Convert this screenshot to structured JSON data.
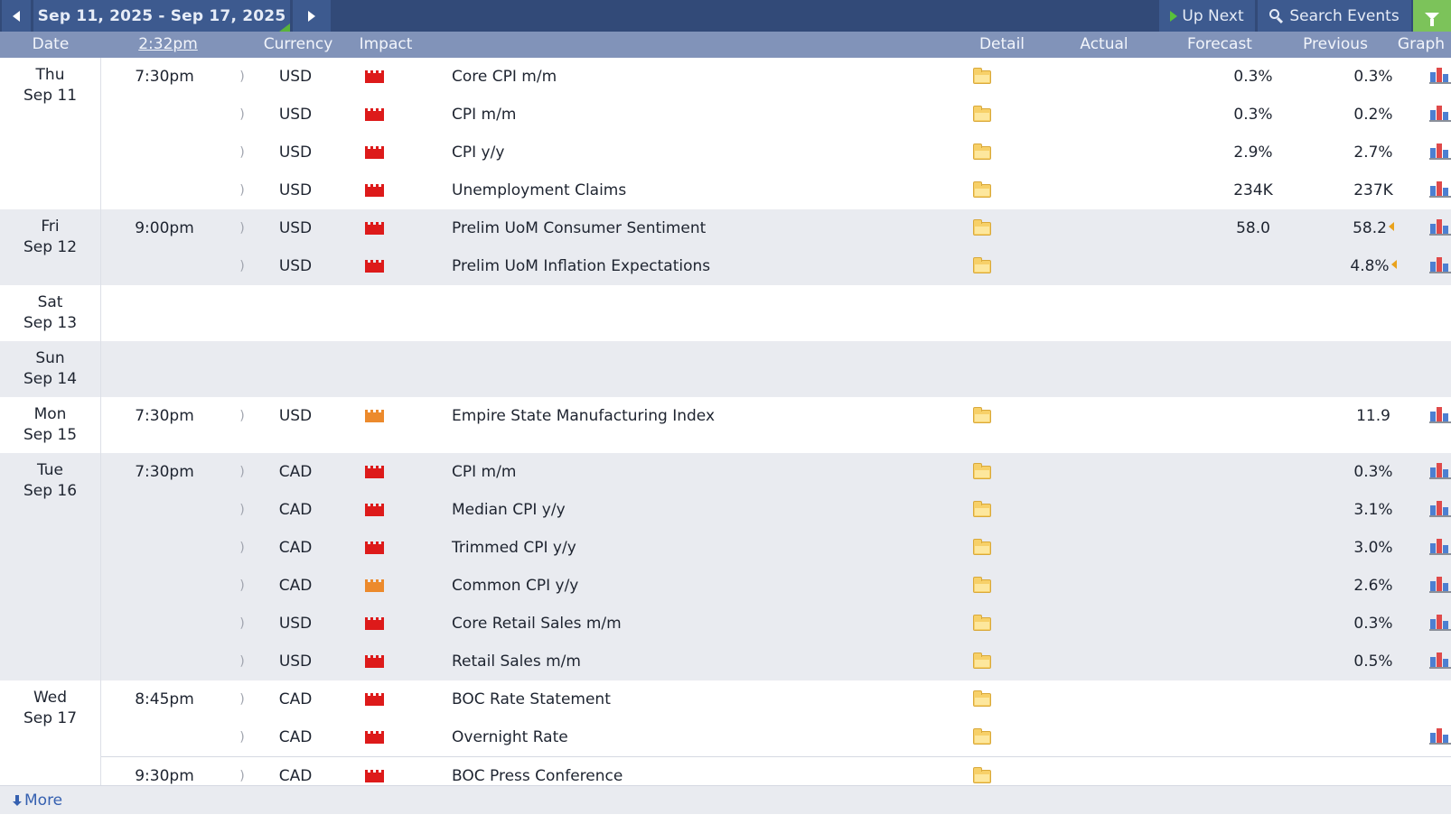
{
  "toolbar": {
    "date_range": "Sep 11, 2025 - Sep 17, 2025",
    "up_next_label": "Up Next",
    "search_label": "Search Events",
    "accent_color": "#324a78",
    "filter_color": "#7cc35a",
    "prev_icon": "triangle-left-icon",
    "next_icon": "triangle-right-icon",
    "search_icon": "magnifier-icon",
    "filter_icon": "funnel-icon"
  },
  "header": {
    "date": "Date",
    "time": "2:32pm",
    "currency": "Currency",
    "impact": "Impact",
    "detail": "Detail",
    "actual": "Actual",
    "forecast": "Forecast",
    "previous": "Previous",
    "graph": "Graph"
  },
  "impact_colors": {
    "high": "#dd1a1a",
    "medium": "#ec8a2c"
  },
  "days": [
    {
      "weekday": "Thu",
      "date": "Sep 11",
      "events": [
        {
          "time": "7:30pm",
          "currency": "USD",
          "impact": "high",
          "name": "Core CPI m/m",
          "actual": "",
          "forecast": "0.3%",
          "previous": "0.3%",
          "revised": false,
          "graph": true
        },
        {
          "time": "",
          "currency": "USD",
          "impact": "high",
          "name": "CPI m/m",
          "actual": "",
          "forecast": "0.3%",
          "previous": "0.2%",
          "revised": false,
          "graph": true
        },
        {
          "time": "",
          "currency": "USD",
          "impact": "high",
          "name": "CPI y/y",
          "actual": "",
          "forecast": "2.9%",
          "previous": "2.7%",
          "revised": false,
          "graph": true
        },
        {
          "time": "",
          "currency": "USD",
          "impact": "high",
          "name": "Unemployment Claims",
          "actual": "",
          "forecast": "234K",
          "previous": "237K",
          "revised": false,
          "graph": true
        }
      ]
    },
    {
      "weekday": "Fri",
      "date": "Sep 12",
      "events": [
        {
          "time": "9:00pm",
          "currency": "USD",
          "impact": "high",
          "name": "Prelim UoM Consumer Sentiment",
          "actual": "",
          "forecast": "58.0",
          "previous": "58.2",
          "revised": true,
          "graph": true
        },
        {
          "time": "",
          "currency": "USD",
          "impact": "high",
          "name": "Prelim UoM Inflation Expectations",
          "actual": "",
          "forecast": "",
          "previous": "4.8%",
          "revised": true,
          "graph": true
        }
      ]
    },
    {
      "weekday": "Sat",
      "date": "Sep 13",
      "events": []
    },
    {
      "weekday": "Sun",
      "date": "Sep 14",
      "events": []
    },
    {
      "weekday": "Mon",
      "date": "Sep 15",
      "events": [
        {
          "time": "7:30pm",
          "currency": "USD",
          "impact": "medium",
          "name": "Empire State Manufacturing Index",
          "actual": "",
          "forecast": "",
          "previous": "11.9",
          "revised": false,
          "graph": true
        }
      ]
    },
    {
      "weekday": "Tue",
      "date": "Sep 16",
      "events": [
        {
          "time": "7:30pm",
          "currency": "CAD",
          "impact": "high",
          "name": "CPI m/m",
          "actual": "",
          "forecast": "",
          "previous": "0.3%",
          "revised": false,
          "graph": true
        },
        {
          "time": "",
          "currency": "CAD",
          "impact": "high",
          "name": "Median CPI y/y",
          "actual": "",
          "forecast": "",
          "previous": "3.1%",
          "revised": false,
          "graph": true
        },
        {
          "time": "",
          "currency": "CAD",
          "impact": "high",
          "name": "Trimmed CPI y/y",
          "actual": "",
          "forecast": "",
          "previous": "3.0%",
          "revised": false,
          "graph": true
        },
        {
          "time": "",
          "currency": "CAD",
          "impact": "medium",
          "name": "Common CPI y/y",
          "actual": "",
          "forecast": "",
          "previous": "2.6%",
          "revised": false,
          "graph": true
        },
        {
          "time": "",
          "currency": "USD",
          "impact": "high",
          "name": "Core Retail Sales m/m",
          "actual": "",
          "forecast": "",
          "previous": "0.3%",
          "revised": false,
          "graph": true
        },
        {
          "time": "",
          "currency": "USD",
          "impact": "high",
          "name": "Retail Sales m/m",
          "actual": "",
          "forecast": "",
          "previous": "0.5%",
          "revised": false,
          "graph": true
        }
      ]
    },
    {
      "weekday": "Wed",
      "date": "Sep 17",
      "events": [
        {
          "time": "8:45pm",
          "currency": "CAD",
          "impact": "high",
          "name": "BOC Rate Statement",
          "actual": "",
          "forecast": "",
          "previous": "",
          "revised": false,
          "graph": false
        },
        {
          "time": "",
          "currency": "CAD",
          "impact": "high",
          "name": "Overnight Rate",
          "actual": "",
          "forecast": "",
          "previous": "",
          "revised": false,
          "graph": true
        },
        {
          "time": "9:30pm",
          "currency": "CAD",
          "impact": "high",
          "name": "BOC Press Conference",
          "actual": "",
          "forecast": "",
          "previous": "",
          "revised": false,
          "graph": false,
          "separator": true
        }
      ]
    }
  ],
  "footer": {
    "more_label": "More"
  }
}
